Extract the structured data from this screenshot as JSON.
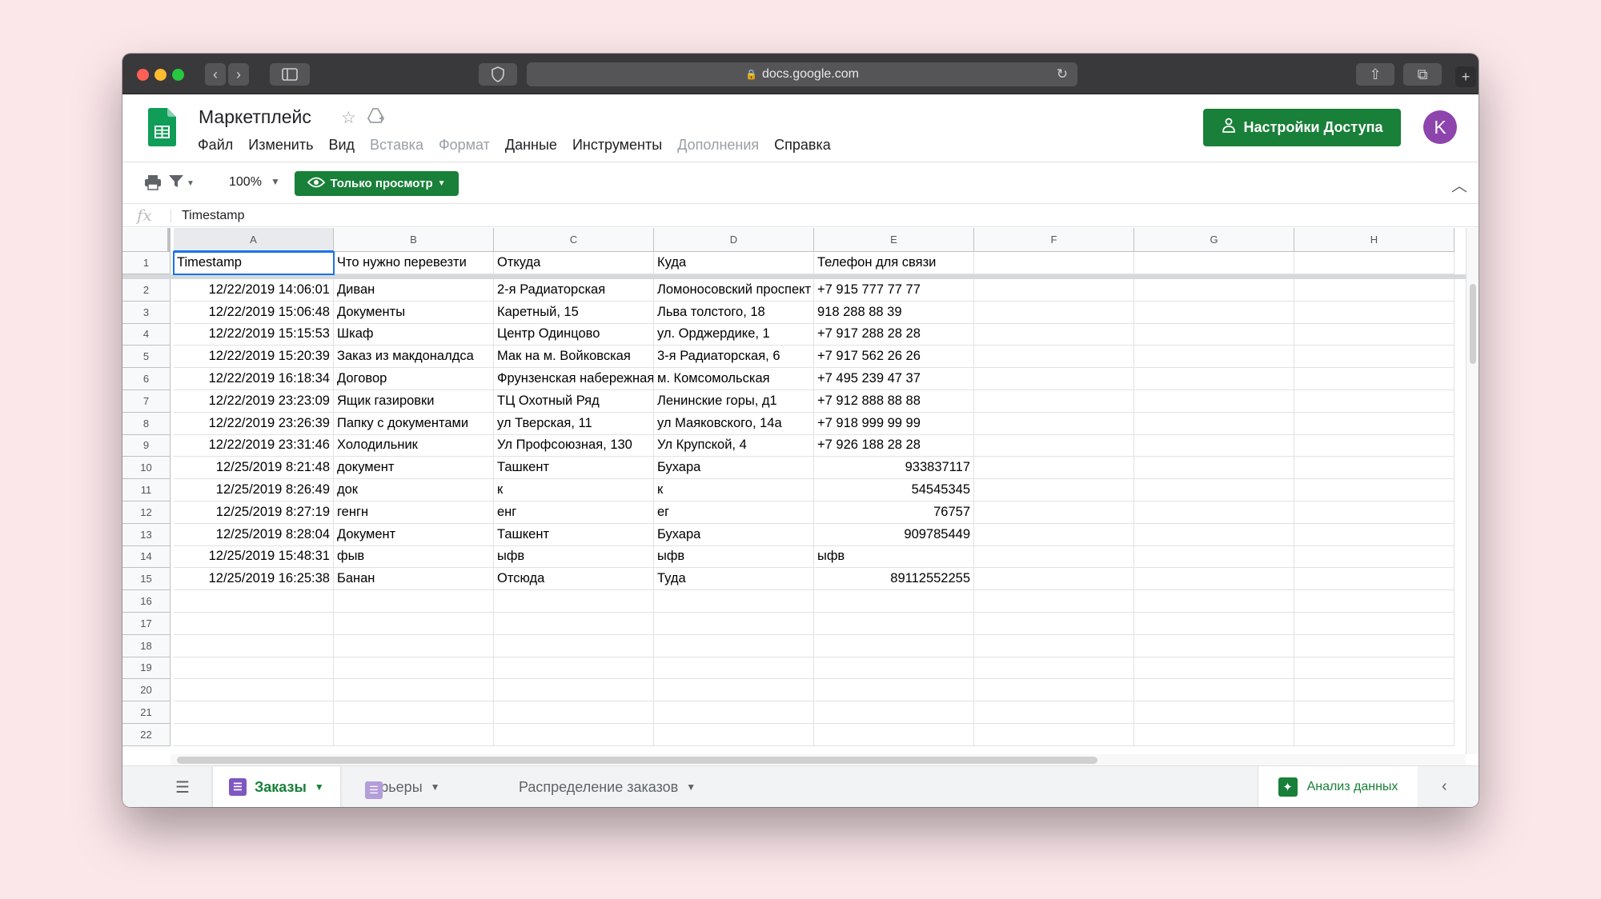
{
  "browser": {
    "url": "docs.google.com"
  },
  "doc": {
    "title": "Маркетплейс",
    "menu": [
      {
        "label": "Файл",
        "enabled": true
      },
      {
        "label": "Изменить",
        "enabled": true
      },
      {
        "label": "Вид",
        "enabled": true
      },
      {
        "label": "Вставка",
        "enabled": false
      },
      {
        "label": "Формат",
        "enabled": false
      },
      {
        "label": "Данные",
        "enabled": true
      },
      {
        "label": "Инструменты",
        "enabled": true
      },
      {
        "label": "Дополнения",
        "enabled": false
      },
      {
        "label": "Справка",
        "enabled": true
      }
    ],
    "share_label": "Настройки Доступа",
    "avatar_letter": "K"
  },
  "toolbar": {
    "zoom": "100%",
    "view_only_label": "Только просмотр"
  },
  "formula_bar": {
    "fx": "fx",
    "value": "Timestamp"
  },
  "columns": [
    "A",
    "B",
    "C",
    "D",
    "E",
    "F",
    "G",
    "H"
  ],
  "rows": [
    {
      "n": "1",
      "cells": [
        "Timestamp",
        "Что нужно перевезти",
        "Откуда",
        "Куда",
        "Телефон для связи"
      ]
    },
    {
      "n": "2",
      "cells": [
        "12/22/2019 14:06:01",
        "Диван",
        "2-я Радиаторская",
        "Ломоносовский проспект",
        "+7 915 777 77 77"
      ]
    },
    {
      "n": "3",
      "cells": [
        "12/22/2019 15:06:48",
        "Документы",
        "Каретный, 15",
        "Льва толстого, 18",
        "918 288 88 39"
      ]
    },
    {
      "n": "4",
      "cells": [
        "12/22/2019 15:15:53",
        "Шкаф",
        "Центр Одинцово",
        "ул. Орджердике, 1",
        "+7 917 288 28 28"
      ]
    },
    {
      "n": "5",
      "cells": [
        "12/22/2019 15:20:39",
        "Заказ из макдоналдса",
        "Мак на м. Войковская",
        "3-я Радиаторская, 6",
        "+7 917 562 26 26"
      ]
    },
    {
      "n": "6",
      "cells": [
        "12/22/2019 16:18:34",
        "Договор",
        "Фрунзенская набережная",
        "м. Комсомольская",
        "+7 495 239 47 37"
      ]
    },
    {
      "n": "7",
      "cells": [
        "12/22/2019 23:23:09",
        "Ящик газировки",
        "ТЦ Охотный Ряд",
        "Ленинские горы, д1",
        "+7 912 888 88 88"
      ]
    },
    {
      "n": "8",
      "cells": [
        "12/22/2019 23:26:39",
        "Папку с документами",
        "ул Тверская, 11",
        "ул Маяковского, 14а",
        "+7 918 999 99 99"
      ]
    },
    {
      "n": "9",
      "cells": [
        "12/22/2019 23:31:46",
        "Холодильник",
        "Ул Профсоюзная, 130",
        "Ул Крупской, 4",
        "+7 926 188 28 28"
      ]
    },
    {
      "n": "10",
      "cells": [
        "12/25/2019 8:21:48",
        "документ",
        "Ташкент",
        "Бухара",
        "933837117"
      ]
    },
    {
      "n": "11",
      "cells": [
        "12/25/2019 8:26:49",
        "док",
        "к",
        "к",
        "54545345"
      ]
    },
    {
      "n": "12",
      "cells": [
        "12/25/2019 8:27:19",
        "генгн",
        "енг",
        "ег",
        "76757"
      ]
    },
    {
      "n": "13",
      "cells": [
        "12/25/2019 8:28:04",
        "Документ",
        "Ташкент",
        "Бухара",
        "909785449"
      ]
    },
    {
      "n": "14",
      "cells": [
        "12/25/2019 15:48:31",
        "фыв",
        "ыфв",
        "ыфв",
        "ыфв"
      ]
    },
    {
      "n": "15",
      "cells": [
        "12/25/2019 16:25:38",
        "Банан",
        "Отсюда",
        "Туда",
        "89112552255"
      ]
    },
    {
      "n": "16",
      "cells": []
    },
    {
      "n": "17",
      "cells": []
    },
    {
      "n": "18",
      "cells": []
    },
    {
      "n": "19",
      "cells": []
    },
    {
      "n": "20",
      "cells": []
    },
    {
      "n": "21",
      "cells": []
    },
    {
      "n": "22",
      "cells": []
    }
  ],
  "tabs": [
    {
      "label": "Заказы",
      "active": true
    },
    {
      "label": "Курьеры",
      "active": false
    },
    {
      "label": "Распределение заказов",
      "active": false
    }
  ],
  "explore_label": "Анализ данных",
  "colors": {
    "accent": "#188038",
    "selection": "#1a73e8",
    "avatar": "#8e44ad"
  }
}
